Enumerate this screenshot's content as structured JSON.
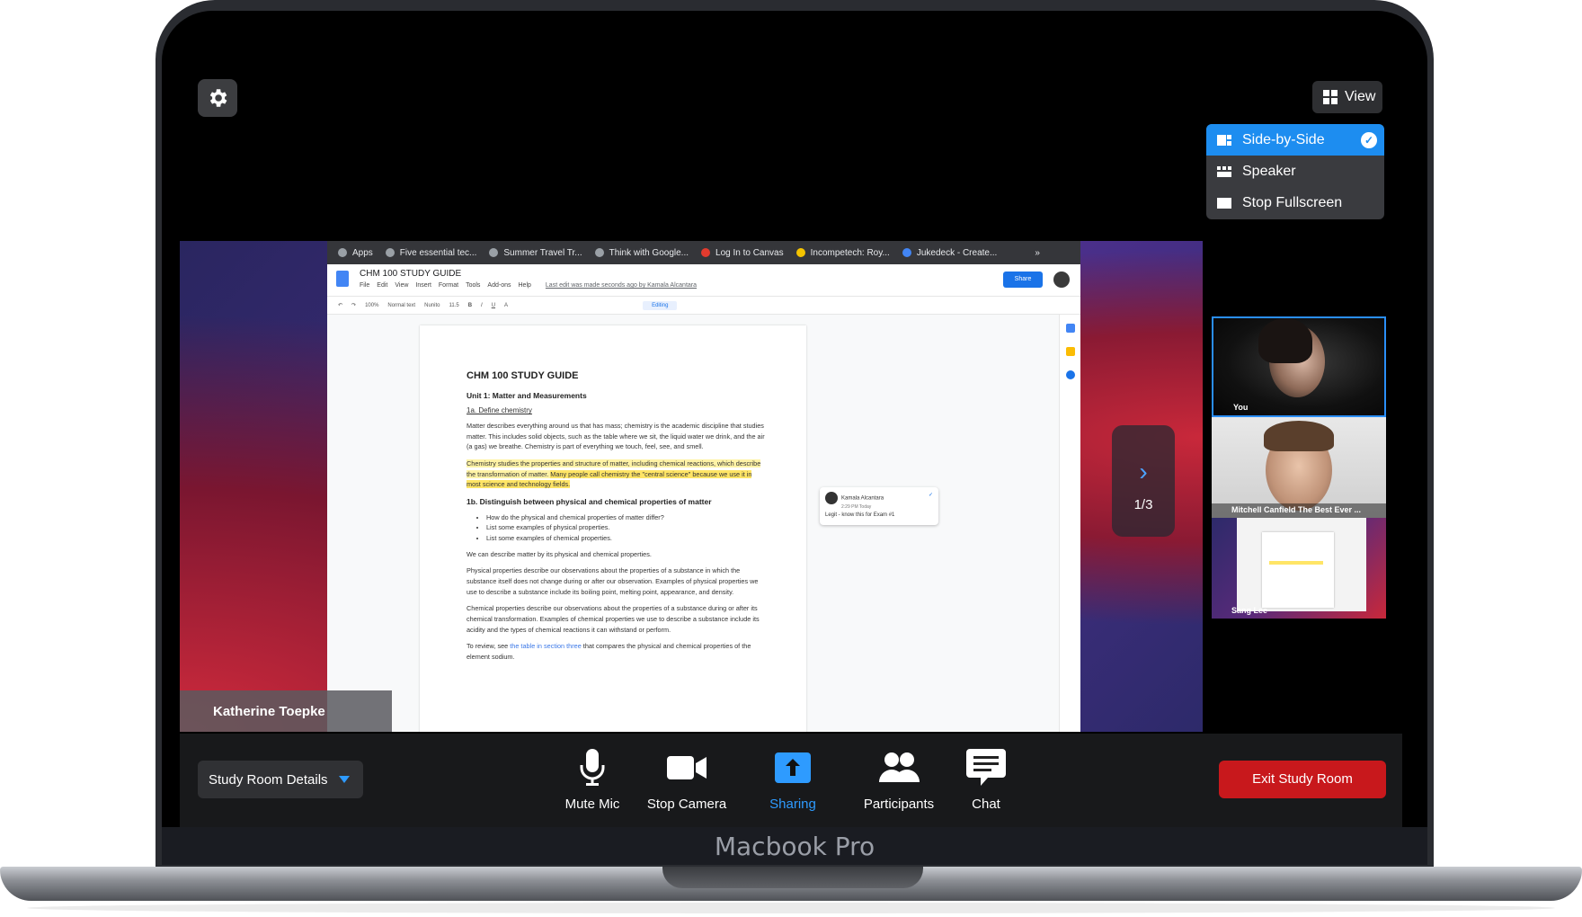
{
  "device": {
    "brand": "Macbook Pro"
  },
  "top": {
    "view_label": "View"
  },
  "view_menu": {
    "items": [
      {
        "label": "Side-by-Side",
        "active": true
      },
      {
        "label": "Speaker",
        "active": false
      },
      {
        "label": "Stop Fullscreen",
        "active": false
      }
    ]
  },
  "share": {
    "presenter": "Katherine Toepke",
    "pager": {
      "arrow": "›",
      "count": "1/3"
    }
  },
  "browser": {
    "bookmarks": [
      "Apps",
      "Five essential tec...",
      "Summer Travel Tr...",
      "Think with Google...",
      "Log In to Canvas",
      "Incompetech: Roy...",
      "Jukedeck - Create...",
      "»"
    ],
    "doc_title": "CHM 100 STUDY GUIDE",
    "menus": [
      "File",
      "Edit",
      "View",
      "Insert",
      "Format",
      "Tools",
      "Add-ons",
      "Help"
    ],
    "last_edit": "Last edit was made seconds ago by Kamala Alcantara",
    "share_label": "Share",
    "toolbar": {
      "zoom": "100%",
      "style": "Normal text",
      "font": "Nunito",
      "size": "11.5",
      "mode": "Editing"
    }
  },
  "doc": {
    "heading": "CHM 100 STUDY GUIDE",
    "unit": "Unit 1: Matter and Measurements",
    "sec1": "1a. Define chemistry",
    "p1": "Matter describes everything around us that has mass; chemistry is the academic discipline that studies matter. This includes solid objects, such as the table where we sit, the liquid water we drink, and the air (a gas) we breathe. Chemistry is part of everything we touch, feel, see, and smell.",
    "p2a": "Chemistry studies the properties and structure of matter, including chemical reactions, which describe the transformation of matter. ",
    "p2b": "Many people call chemistry the \"central science\" because we use it in most science and technology fields.",
    "sec2": "1b. Distinguish between physical and chemical properties of matter",
    "bullets": [
      "How do the physical and chemical properties of matter differ?",
      "List some examples of physical properties.",
      "List some examples of chemical properties."
    ],
    "p3": "We can describe matter by its physical and chemical properties.",
    "p4": "Physical properties describe our observations about the properties of a substance in which the substance itself does not change during or after our observation. Examples of physical properties we use to describe a substance include its boiling point, melting point, appearance, and density.",
    "p5": "Chemical properties describe our observations about the properties of a substance during or after its chemical transformation. Examples of chemical properties we use to describe a substance include its acidity and the types of chemical reactions it can withstand or perform.",
    "p6a": "To review, see ",
    "p6link": "the table in section three",
    "p6b": " that compares the physical and chemical properties of the element sodium."
  },
  "comment": {
    "author": "Kamala Alcantara",
    "time": "2:29 PM Today",
    "text": "Legit - know this for Exam #1"
  },
  "participants": [
    {
      "name": "You"
    },
    {
      "name": "Mitchell Canfield The Best Ever ..."
    },
    {
      "name": "Sang Lee"
    }
  ],
  "controls": {
    "details": "Study Room Details",
    "mute": "Mute Mic",
    "camera": "Stop Camera",
    "sharing": "Sharing",
    "participants": "Participants",
    "chat": "Chat",
    "exit": "Exit Study Room"
  },
  "colors": {
    "accent": "#1d8df0",
    "exit": "#c8181c",
    "bar": "#18191b"
  }
}
